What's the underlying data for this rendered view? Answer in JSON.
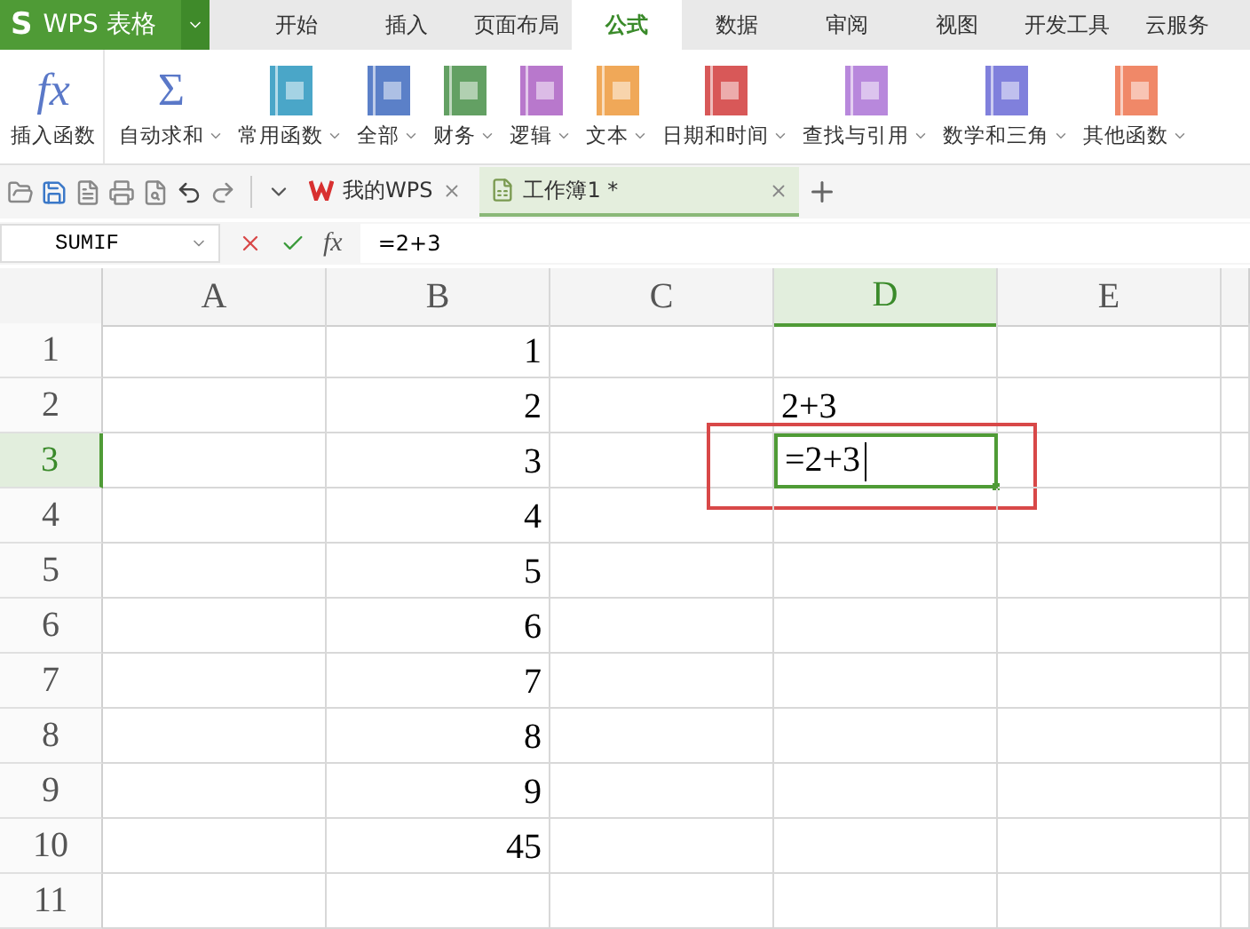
{
  "app": {
    "mark": "S",
    "name": "WPS 表格"
  },
  "menu_tabs": [
    {
      "label": "开始",
      "selected": false
    },
    {
      "label": "插入",
      "selected": false
    },
    {
      "label": "页面布局",
      "selected": false
    },
    {
      "label": "公式",
      "selected": true
    },
    {
      "label": "数据",
      "selected": false
    },
    {
      "label": "审阅",
      "selected": false
    },
    {
      "label": "视图",
      "selected": false
    },
    {
      "label": "开发工具",
      "selected": false
    },
    {
      "label": "云服务",
      "selected": false
    }
  ],
  "ribbon": [
    {
      "label": "插入函数",
      "kind": "glyph",
      "glyph": "fx",
      "dropdown": false
    },
    {
      "label": "自动求和",
      "kind": "glyph",
      "glyph": "Σ",
      "dropdown": true
    },
    {
      "label": "常用函数",
      "kind": "book",
      "color": "#4aa6c8",
      "dropdown": true
    },
    {
      "label": "全部",
      "kind": "book",
      "color": "#5b80c8",
      "dropdown": true
    },
    {
      "label": "财务",
      "kind": "book",
      "color": "#63a063",
      "dropdown": true
    },
    {
      "label": "逻辑",
      "kind": "book",
      "color": "#b878cc",
      "dropdown": true
    },
    {
      "label": "文本",
      "kind": "book",
      "color": "#f0a858",
      "dropdown": true
    },
    {
      "label": "日期和时间",
      "kind": "book",
      "color": "#d85858",
      "dropdown": true
    },
    {
      "label": "查找与引用",
      "kind": "book",
      "color": "#b888dc",
      "dropdown": true
    },
    {
      "label": "数学和三角",
      "kind": "book",
      "color": "#8080dc",
      "dropdown": true
    },
    {
      "label": "其他函数",
      "kind": "book",
      "color": "#f08868",
      "dropdown": true
    }
  ],
  "doc_tabs": [
    {
      "label": "我的WPS",
      "kind": "home",
      "selected": false
    },
    {
      "label": "工作簿1 *",
      "kind": "sheet",
      "selected": true
    }
  ],
  "formula_bar": {
    "name_box": "SUMIF",
    "function_label": "fx",
    "formula": "=2+3"
  },
  "grid": {
    "columns": [
      {
        "label": "A",
        "selected": false
      },
      {
        "label": "B",
        "selected": false
      },
      {
        "label": "C",
        "selected": false
      },
      {
        "label": "D",
        "selected": true
      },
      {
        "label": "E",
        "selected": false
      }
    ],
    "rows": [
      {
        "number": "1",
        "selected": false,
        "column_b": "1"
      },
      {
        "number": "2",
        "selected": false,
        "column_b": "2",
        "column_d": {
          "value": "2+3",
          "kind": "text"
        }
      },
      {
        "number": "3",
        "selected": true,
        "column_b": "3",
        "column_d": {
          "value": "=2+3",
          "kind": "editing",
          "highlighted": true
        }
      },
      {
        "number": "4",
        "selected": false,
        "column_b": "4"
      },
      {
        "number": "5",
        "selected": false,
        "column_b": "5"
      },
      {
        "number": "6",
        "selected": false,
        "column_b": "6"
      },
      {
        "number": "7",
        "selected": false,
        "column_b": "7"
      },
      {
        "number": "8",
        "selected": false,
        "column_b": "8"
      },
      {
        "number": "9",
        "selected": false,
        "column_b": "9"
      },
      {
        "number": "10",
        "selected": false,
        "column_b": "45"
      },
      {
        "number": "11",
        "selected": false
      }
    ]
  }
}
